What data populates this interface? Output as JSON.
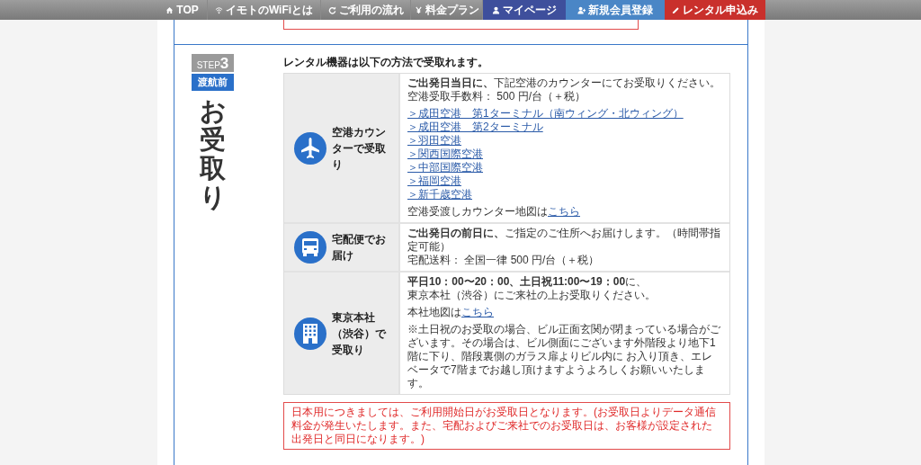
{
  "nav": [
    {
      "label": "TOP",
      "kind": "plain"
    },
    {
      "label": "イモトのWiFiとは",
      "kind": "plain"
    },
    {
      "label": "ご利用の流れ",
      "kind": "plain"
    },
    {
      "label": "料金プラン",
      "kind": "plain"
    },
    {
      "label": "マイページ",
      "kind": "mypage"
    },
    {
      "label": "新規会員登録",
      "kind": "register"
    },
    {
      "label": "レンタル申込み",
      "kind": "apply"
    }
  ],
  "step": {
    "badge_word": "STEP",
    "badge_number": "3",
    "phase": "渡航前",
    "title": "お受取り"
  },
  "heading": "レンタル機器は以下の方法で受取れます。",
  "methods": [
    {
      "label": "空港カウンターで受取り",
      "blocks": [
        {
          "kind": "text",
          "lines": [
            "**ご出発日当日に、**下記空港のカウンターにてお受取りください。",
            "空港受取手数料： 500 円/台（＋税）"
          ]
        },
        {
          "kind": "links",
          "items": [
            "＞成田空港　第1ターミナル（南ウィング・北ウィング）",
            "＞成田空港　第2ターミナル",
            "＞羽田空港",
            "＞関西国際空港",
            "＞中部国際空港",
            "＞福岡空港",
            "＞新千歳空港"
          ]
        },
        {
          "kind": "textlink",
          "text": "空港受渡しカウンター地図は",
          "link": "こちら"
        }
      ]
    },
    {
      "label": "宅配便でお届け",
      "blocks": [
        {
          "kind": "text",
          "lines": [
            "**ご出発日の前日に、**ご指定のご住所へお届けします。（時間帯指定可能）",
            "宅配送料： 全国一律 500 円/台（＋税）"
          ]
        }
      ]
    },
    {
      "label": "東京本社（渋谷）で受取り",
      "blocks": [
        {
          "kind": "text",
          "lines": [
            "**平日10：00〜20：00、土日祝11:00〜19：00**に、",
            "東京本社（渋谷）にご来社の上お受取りください。"
          ]
        },
        {
          "kind": "textlink",
          "text": "本社地図は",
          "link": "こちら"
        },
        {
          "kind": "text",
          "lines": [
            "※土日祝のお受取の場合、ビル正面玄関が閉まっている場合がございます。その場合は、ビル側面にございます外階段より地下1階に下り、階段裏側のガラス扉よりビル内に お入り頂き、エレベータで7階までお越し頂けますようよろしくお願いいたします。"
          ]
        }
      ]
    }
  ],
  "note": "日本用につきましては、ご利用開始日がお受取日となります。(お受取日よりデータ通信料金が発生いたします。また、宅配およびご来社でのお受取日は、お客様が設定された出発日と同日になります。)"
}
